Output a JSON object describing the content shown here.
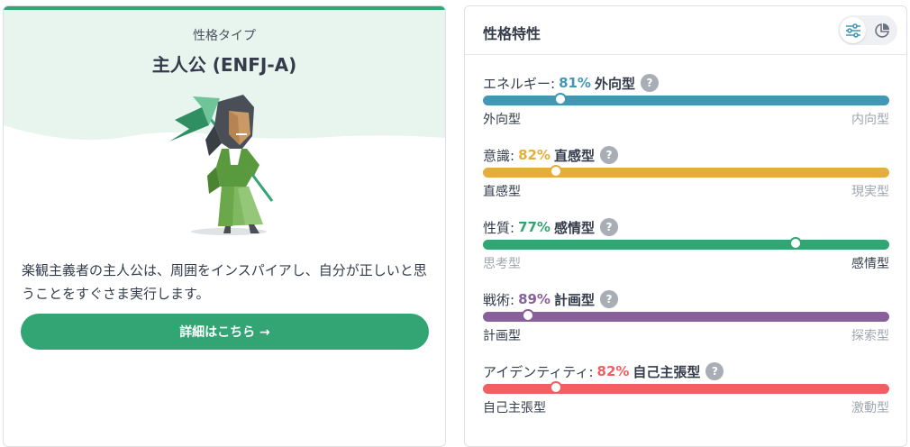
{
  "personality": {
    "type_label": "性格タイプ",
    "type_name": "主人公 (ENFJ-A)",
    "description": "楽観主義者の主人公は、周囲をインスパイアし、自分が正しいと思うことをすぐさま実行します。",
    "detail_button": "詳細はこちら →"
  },
  "traits_panel": {
    "title": "性格特性",
    "view_icons": [
      "sliders-icon",
      "pie-chart-icon"
    ],
    "traits": [
      {
        "label": "エネルギー:",
        "percent": "81%",
        "type": "外向型",
        "value": 0.19,
        "color": "#4298b4",
        "left_end": "外向型",
        "right_end": "内向型",
        "dominant": "left"
      },
      {
        "label": "意識:",
        "percent": "82%",
        "type": "直感型",
        "value": 0.18,
        "color": "#e4ae3a",
        "left_end": "直感型",
        "right_end": "現実型",
        "dominant": "left"
      },
      {
        "label": "性質:",
        "percent": "77%",
        "type": "感情型",
        "value": 0.77,
        "color": "#33a474",
        "left_end": "思考型",
        "right_end": "感情型",
        "dominant": "right"
      },
      {
        "label": "戦術:",
        "percent": "89%",
        "type": "計画型",
        "value": 0.11,
        "color": "#88619a",
        "left_end": "計画型",
        "right_end": "探索型",
        "dominant": "left"
      },
      {
        "label": "アイデンティティ:",
        "percent": "82%",
        "type": "自己主張型",
        "value": 0.18,
        "color": "#f25e62",
        "left_end": "自己主張型",
        "right_end": "激動型",
        "dominant": "left"
      }
    ],
    "help_glyph": "?"
  }
}
